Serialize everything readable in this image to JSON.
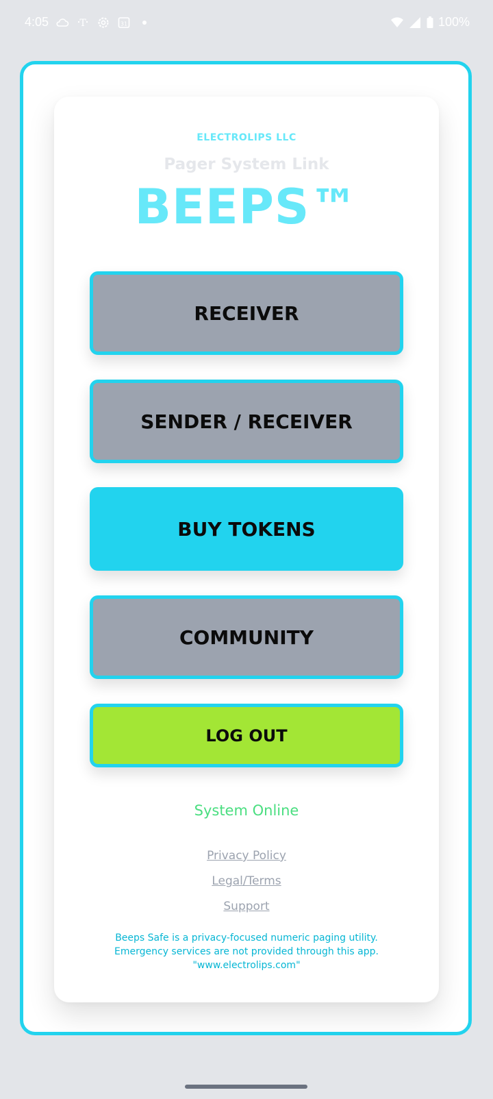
{
  "status_bar": {
    "time": "4:05",
    "battery": "100%",
    "icons": [
      "cloud-icon",
      "tmobile-icon",
      "settings-gear-icon",
      "calendar-icon",
      "notification-dot-icon",
      "wifi-icon",
      "signal-icon",
      "battery-icon"
    ]
  },
  "header": {
    "company": "ELECTROLIPS LLC",
    "subtitle": "Pager System Link",
    "brand": "BEEPS™"
  },
  "menu": {
    "receiver": "RECEIVER",
    "sender_receiver": "SENDER / RECEIVER",
    "buy_tokens": "BUY TOKENS",
    "community": "COMMUNITY",
    "logout": "LOG OUT"
  },
  "footer": {
    "status": "System Online",
    "privacy": "Privacy Policy",
    "legal": "Legal/Terms",
    "support": "Support",
    "disclaimer_line1": "Beeps Safe is a privacy-focused numeric paging utility.",
    "disclaimer_line2": "Emergency services are not provided through this app.",
    "disclaimer_line3": "\"www.electrolips.com\""
  },
  "colors": {
    "accent": "#22d3ee",
    "button_gray": "#9ca3af",
    "logout_green": "#a3e635",
    "status_green": "#4ade80"
  }
}
